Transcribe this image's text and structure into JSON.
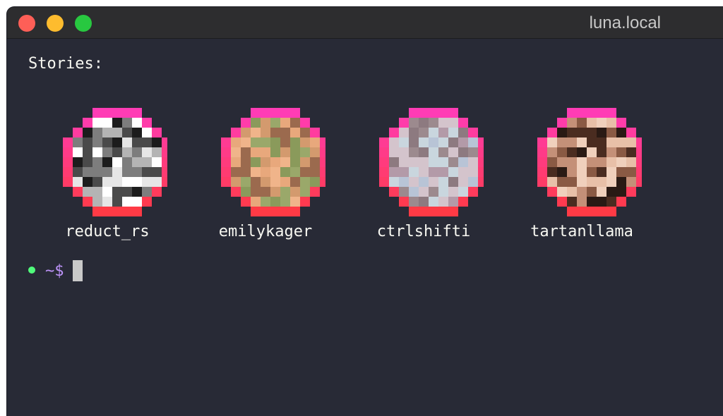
{
  "window": {
    "title": "luna.local"
  },
  "terminal": {
    "heading": "Stories:",
    "stories": [
      {
        "username": "reduct_rs",
        "palette": [
          "#1c1c1c",
          "#4a4a4a",
          "#7d7d7d",
          "#b4b4b4",
          "#e6e6e6",
          "#ffffff"
        ]
      },
      {
        "username": "emilykager",
        "palette": [
          "#8a9a5b",
          "#9aa86a",
          "#d39a6e",
          "#e8a87c",
          "#f0b48a",
          "#9b6a4e"
        ]
      },
      {
        "username": "ctrlshifti",
        "palette": [
          "#c9d6de",
          "#b8c4d6",
          "#9c8a8e",
          "#b39aa8",
          "#d4c4cc",
          "#8d7a80"
        ]
      },
      {
        "username": "tartanllama",
        "palette": [
          "#2a1a14",
          "#4a2c20",
          "#8a5a44",
          "#c49078",
          "#e8c0a8",
          "#f0d0bc"
        ]
      }
    ],
    "prompt": {
      "symbol": "~$"
    }
  },
  "colors": {
    "background": "#282a36",
    "ring_top": "#ff3cc0",
    "ring_bottom": "#ff3a3a",
    "prompt_dot": "#50fa7b",
    "prompt_text": "#bd93f9"
  }
}
